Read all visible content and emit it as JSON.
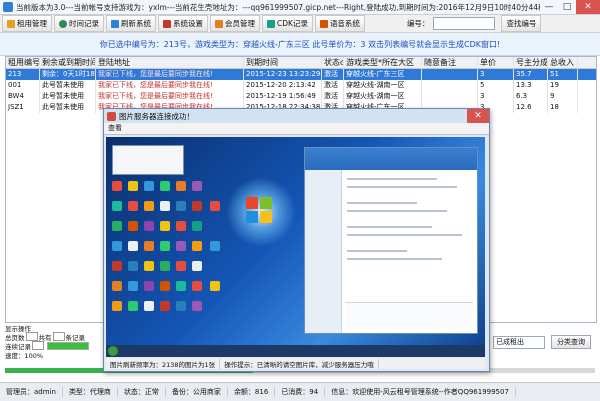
{
  "window": {
    "title": "当前版本为3.0---当前帐号支持游戏为：yxlm---当前花生壳地址为：---qq961999507.gicp.net---Right,登陆成功,到期时间为:2016年12月9日10时40分44秒",
    "controls": [
      "—",
      "□",
      "✕"
    ]
  },
  "toolbar": {
    "buttons": [
      {
        "label": "租用管理",
        "icon": "rent-manage-icon",
        "color": "#e0a020"
      },
      {
        "label": "时间记录",
        "icon": "clock-icon",
        "color": "#2e8b57"
      },
      {
        "label": "刷新系统",
        "icon": "refresh-icon",
        "color": "#2e7fd6"
      },
      {
        "label": "系统设置",
        "icon": "settings-icon",
        "color": "#c0392b"
      },
      {
        "label": "会员管理",
        "icon": "member-icon",
        "color": "#e67e22"
      },
      {
        "label": "CDK记录",
        "icon": "cdk-icon",
        "color": "#16a085"
      },
      {
        "label": "语音系统",
        "icon": "voice-icon",
        "color": "#d35400"
      }
    ],
    "number_label": "编号：",
    "number_value": "",
    "query_button": "查找编号"
  },
  "banner": "你已选中编号为：213号，游戏类型为：穿越火线-广东三区  此号单价为：3  双击列表编号就会显示生成CDK窗口!",
  "table": {
    "columns": [
      "租用编号",
      "剩余或到期时间",
      "登陆地址",
      "到期时间",
      "状态c",
      "游戏类型*所在大区",
      "随意备注",
      "单价",
      "号主分成",
      "总收入"
    ],
    "rows": [
      {
        "cells": [
          "213",
          "剩余：0天1时18分",
          "我家已下线，您是最后要同步我在线!",
          "2015-12-23 13:23:29",
          "激活",
          "穿越火线-广东三区",
          "",
          "3",
          "35.7",
          "51"
        ],
        "selected": true
      },
      {
        "cells": [
          "001",
          "此号暂未使用",
          "我家已下线，您是最后要同步我在线!",
          "2015-12-20 2:13:42",
          "激活",
          "穿越火线-湖南一区",
          "",
          "5",
          "13.3",
          "19"
        ],
        "selected": false
      },
      {
        "cells": [
          "BW4",
          "此号暂未使用",
          "我家已下线，您是最后要同步我在线!",
          "2015-12-19 1:56:49",
          "激活",
          "穿越火线-湖南一区",
          "",
          "3",
          "6.3",
          "9"
        ],
        "selected": false
      },
      {
        "cells": [
          "JSZ1",
          "此号暂未使用",
          "我家已下线，您是最后要同步我在线!",
          "2015-12-18 22:34:38",
          "激活",
          "穿越火线-广东一区",
          "",
          "3",
          "12.6",
          "18"
        ],
        "selected": false
      }
    ]
  },
  "bottom": {
    "display_ops": "显示操作",
    "line1_a": "总页数",
    "line1_b": "共有",
    "line1_c": "条记录",
    "line2_label": "连续记录",
    "speed_label": "速度：100%",
    "speed_value": 1.0,
    "progress": 0.42,
    "select_value": "已成租出",
    "select_placeholder": "",
    "query_button": "分类查询"
  },
  "popup": {
    "title": "图片服务器连接成功！",
    "menu_item": "查看",
    "close": "✕",
    "status": [
      "图片刷新频率为：2138的图片为1张",
      "操作提示：已清晰的请空图片库，减少服务器压力哦"
    ]
  },
  "statusbar": {
    "items": [
      "管理员：admin",
      "类型：代理商",
      "状态：正常",
      "备份：公用商家",
      "余额：816",
      "已消费：94",
      "信息：欢迎使用-风云租号管理系统--作者QQ961999507"
    ]
  },
  "colors": {
    "accent": "#2f79d8",
    "banner_text": "#1a4fbf",
    "progress": "#37b24d",
    "close": "#d9534f"
  }
}
